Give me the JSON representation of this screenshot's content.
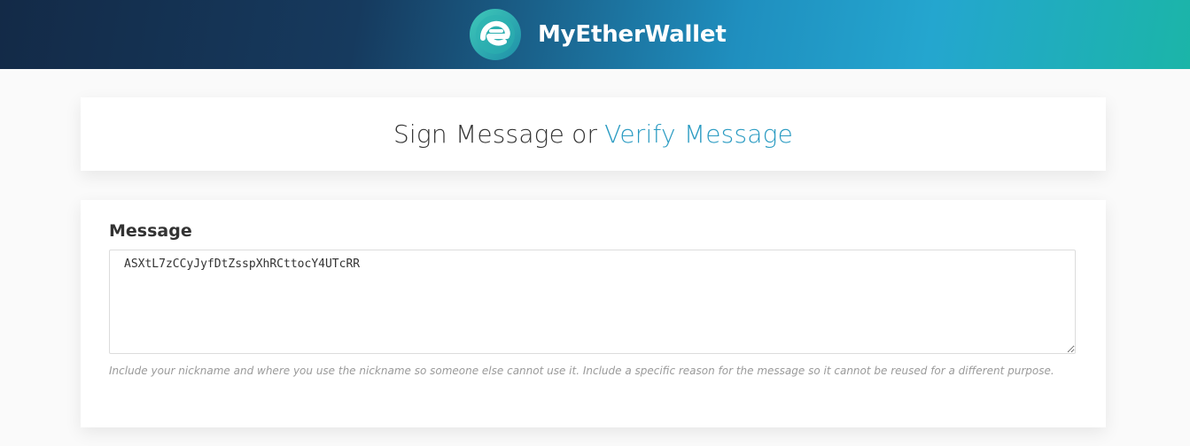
{
  "header": {
    "brand_name": "MyEtherWallet",
    "logo_icon": "myetherwallet-logo-icon",
    "gradient_colors": [
      "#132a47",
      "#1f8fbf",
      "#1bb5a8"
    ]
  },
  "title": {
    "sign_label": "Sign Message",
    "separator": "or",
    "verify_link": "Verify Message",
    "link_color": "#2a9bc2"
  },
  "message": {
    "label": "Message",
    "value": "ASXtL7zCCyJyfDtZsspXhRCttocY4UTcRR",
    "help_text": "Include your nickname and where you use the nickname so someone else cannot use it. Include a specific reason for the message so it cannot be reused for a different purpose."
  }
}
